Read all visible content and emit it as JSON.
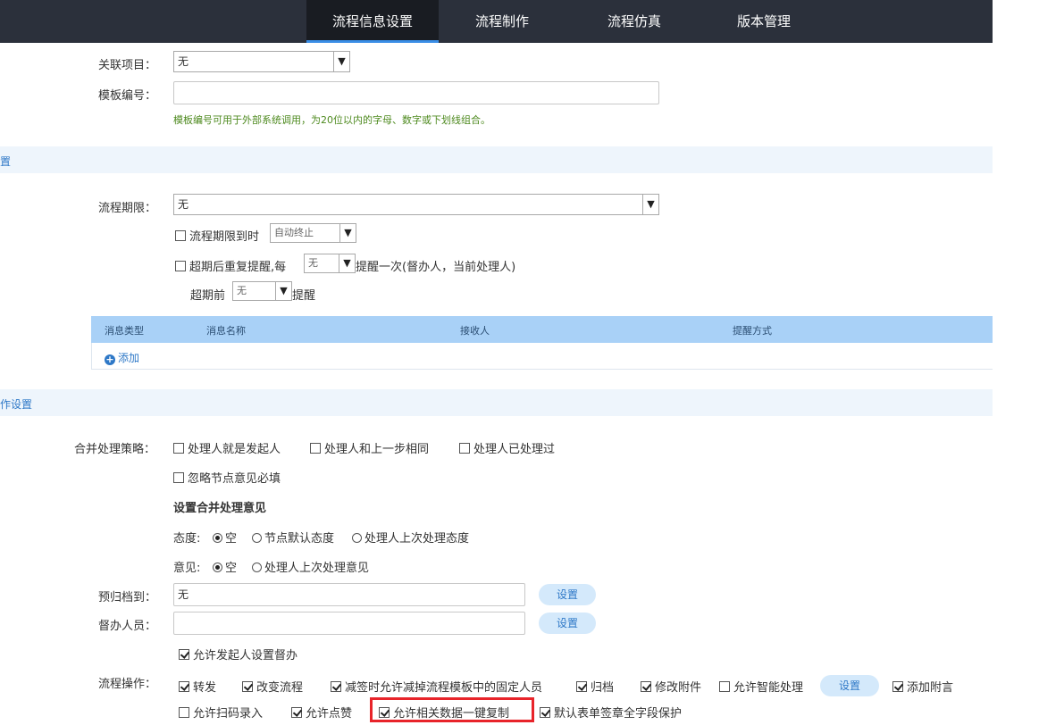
{
  "tabs": [
    "流程信息设置",
    "流程制作",
    "流程仿真",
    "版本管理"
  ],
  "basic": {
    "project_label": "关联项目：",
    "project_value": "无",
    "template_label": "模板编号：",
    "template_value": "",
    "template_hint": "模板编号可用于外部系统调用，为20位以内的字母、数字或下划线组合。"
  },
  "section1_title": "置",
  "deadline": {
    "label": "流程期限：",
    "value": "无",
    "expire_label": "流程期限到时",
    "expire_value": "自动终止",
    "repeat_prefix": "超期后重复提醒,每",
    "repeat_value": "无",
    "repeat_suffix": "提醒一次(督办人，当前处理人)",
    "before_prefix": "超期前",
    "before_value": "无",
    "before_suffix": "提醒"
  },
  "table": {
    "headers": [
      "消息类型",
      "消息名称",
      "接收人",
      "提醒方式"
    ],
    "add_label": "添加"
  },
  "section2_title": "作设置",
  "merge": {
    "label": "合并处理策略：",
    "options": [
      "处理人就是发起人",
      "处理人和上一步相同",
      "处理人已处理过"
    ],
    "ignore": "忽略节点意见必填",
    "title": "设置合并处理意见",
    "attitude_label": "态度:",
    "attitude_options": [
      "空",
      "节点默认态度",
      "处理人上次处理态度"
    ],
    "opinion_label": "意见:",
    "opinion_options": [
      "空",
      "处理人上次处理意见"
    ]
  },
  "archive": {
    "label": "预归档到：",
    "value": "无",
    "button": "设置"
  },
  "supervisor": {
    "label": "督办人员：",
    "value": "",
    "button": "设置"
  },
  "allow_supervise": "允许发起人设置督办",
  "operations": {
    "label": "流程操作：",
    "row1": [
      "转发",
      "改变流程",
      "减签时允许减掉流程模板中的固定人员",
      "归档",
      "修改附件",
      "允许智能处理"
    ],
    "settings_button": "设置",
    "add_comment": "添加附言",
    "row2": [
      "允许扫码录入",
      "允许点赞",
      "允许相关数据一键复制",
      "默认表单签章全字段保护"
    ]
  }
}
